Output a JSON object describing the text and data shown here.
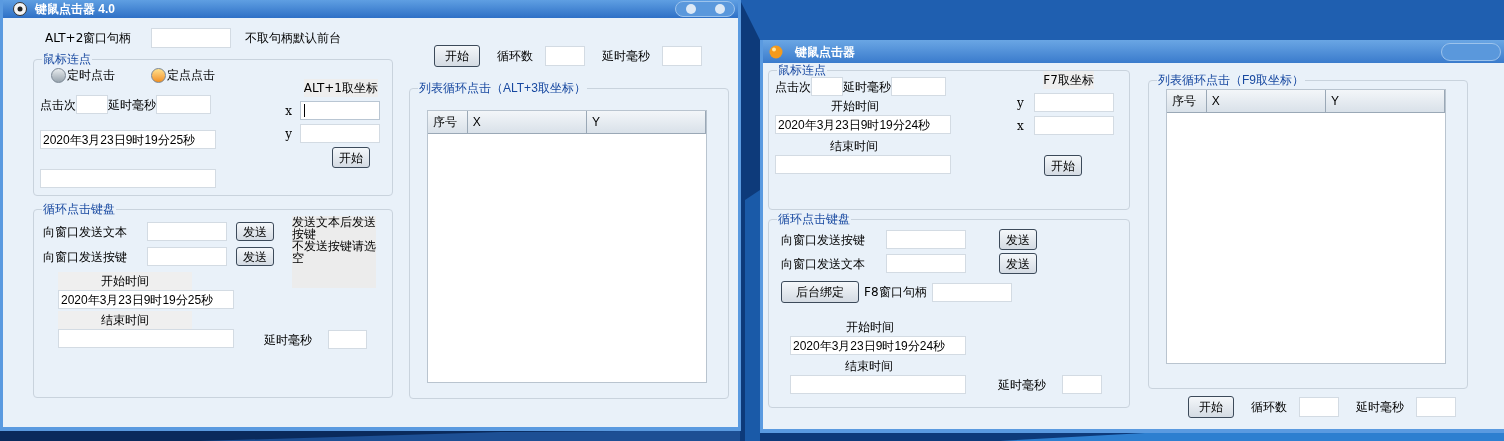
{
  "window_a": {
    "title": "键鼠点击器 4.0",
    "handle": {
      "label": "ALT+2窗口句柄",
      "note": "不取句柄默认前台"
    },
    "mouse_group": {
      "title": "鼠标连点",
      "modes": [
        {
          "label": "定时点击",
          "selected": false
        },
        {
          "label": "定点点击",
          "selected": true
        }
      ],
      "clicks_label": "点击次",
      "delay_label": "延时毫秒",
      "time_value": "2020年3月23日9时19分25秒",
      "coord_label": "ALT+1取坐标",
      "coords": [
        {
          "label": "x",
          "focused": true
        },
        {
          "label": "y",
          "focused": false
        }
      ],
      "start_button": "开始"
    },
    "keyboard_group": {
      "title": "循环点击键盘",
      "rows": [
        {
          "label": "向窗口发送文本",
          "button": "发送"
        },
        {
          "label": "向窗口发送按键",
          "button": "发送"
        }
      ],
      "hints": [
        "发送文本后发送按键",
        "不发送按键请选空"
      ],
      "start_label": "开始时间",
      "start_value": "2020年3月23日9时19分25秒",
      "end_label": "结束时间",
      "delay_label": "延时毫秒"
    },
    "loop": {
      "start_button": "开始",
      "count_label": "循环数",
      "delay_label": "延时毫秒"
    },
    "list_group": {
      "title": "列表循环点击（ALT+3取坐标）",
      "columns": [
        "序号",
        "X",
        "Y"
      ]
    }
  },
  "window_b": {
    "title": "键鼠点击器",
    "mouse_group": {
      "title": "鼠标连点",
      "clicks_label": "点击次",
      "delay_label": "延时毫秒",
      "start_label": "开始时间",
      "start_value": "2020年3月23日9时19分24秒",
      "end_label": "结束时间",
      "coord_label": "F7取坐标",
      "coords": [
        {
          "label": "y"
        },
        {
          "label": "x"
        }
      ],
      "start_button": "开始"
    },
    "keyboard_group": {
      "title": "循环点击键盘",
      "rows": [
        {
          "label": "向窗口发送按键",
          "button": "发送"
        },
        {
          "label": "向窗口发送文本",
          "button": "发送"
        }
      ],
      "bind_button": "后台绑定",
      "handle_label": "F8窗口句柄",
      "start_label": "开始时间",
      "start_value": "2020年3月23日9时19分24秒",
      "end_label": "结束时间",
      "delay_label": "延时毫秒"
    },
    "list_group": {
      "title": "列表循环点击（F9取坐标）",
      "columns": [
        "序号",
        "X",
        "Y"
      ]
    },
    "loop": {
      "start_button": "开始",
      "count_label": "循环数",
      "delay_label": "延时毫秒"
    }
  }
}
